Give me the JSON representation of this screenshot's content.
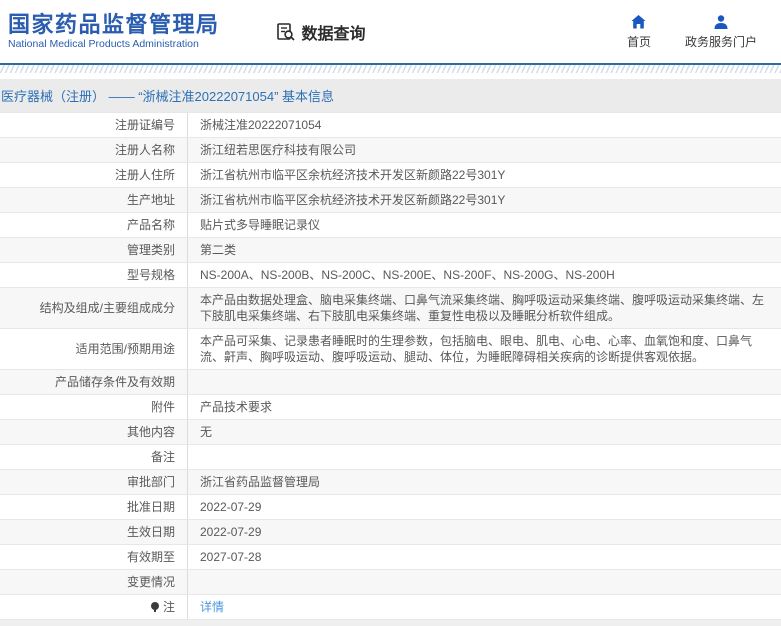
{
  "header": {
    "logo_title": "国家药品监督管理局",
    "logo_subtitle": "National Medical Products Administration",
    "section_title": "数据查询",
    "nav": [
      {
        "label": "首页",
        "icon": "home-icon"
      },
      {
        "label": "政务服务门户",
        "icon": "user-icon"
      }
    ]
  },
  "breadcrumb": {
    "text": "医疗器械（注册） —— “浙械注准20222071054” 基本信息"
  },
  "colors": {
    "brand_blue": "#2a5db0",
    "nav_icon_blue": "#1b57c2",
    "top_line_blue": "#2e6da4",
    "breadcrumb_blue": "#2d70b6",
    "link_blue": "#4b97e0",
    "band_gray": "#ebebeb",
    "alt_row_gray": "#f7f7f7"
  },
  "table": {
    "rows": [
      {
        "label": "注册证编号",
        "value": "浙械注准20222071054"
      },
      {
        "label": "注册人名称",
        "value": "浙江纽若思医疗科技有限公司"
      },
      {
        "label": "注册人住所",
        "value": "浙江省杭州市临平区余杭经济技术开发区新颜路22号301Y"
      },
      {
        "label": "生产地址",
        "value": "浙江省杭州市临平区余杭经济技术开发区新颜路22号301Y"
      },
      {
        "label": "产品名称",
        "value": "贴片式多导睡眠记录仪"
      },
      {
        "label": "管理类别",
        "value": "第二类"
      },
      {
        "label": "型号规格",
        "value": "NS-200A、NS-200B、NS-200C、NS-200E、NS-200F、NS-200G、NS-200H"
      },
      {
        "label": "结构及组成/主要组成成分",
        "value": "本产品由数据处理盒、脑电采集终端、口鼻气流采集终端、胸呼吸运动采集终端、腹呼吸运动采集终端、左下肢肌电采集终端、右下肢肌电采集终端、重复性电极以及睡眠分析软件组成。"
      },
      {
        "label": "适用范围/预期用途",
        "value": "本产品可采集、记录患者睡眠时的生理参数，包括脑电、眼电、肌电、心电、心率、血氧饱和度、口鼻气流、鼾声、胸呼吸运动、腹呼吸运动、腿动、体位，为睡眠障碍相关疾病的诊断提供客观依据。"
      },
      {
        "label": "产品储存条件及有效期",
        "value": ""
      },
      {
        "label": "附件",
        "value": "产品技术要求"
      },
      {
        "label": "其他内容",
        "value": "无"
      },
      {
        "label": "备注",
        "value": ""
      },
      {
        "label": "审批部门",
        "value": "浙江省药品监督管理局"
      },
      {
        "label": "批准日期",
        "value": "2022-07-29"
      },
      {
        "label": "生效日期",
        "value": "2022-07-29"
      },
      {
        "label": "有效期至",
        "value": "2027-07-28"
      },
      {
        "label": "变更情况",
        "value": ""
      },
      {
        "label": "注",
        "value": "详情",
        "link": true,
        "icon": "note-icon"
      }
    ]
  }
}
